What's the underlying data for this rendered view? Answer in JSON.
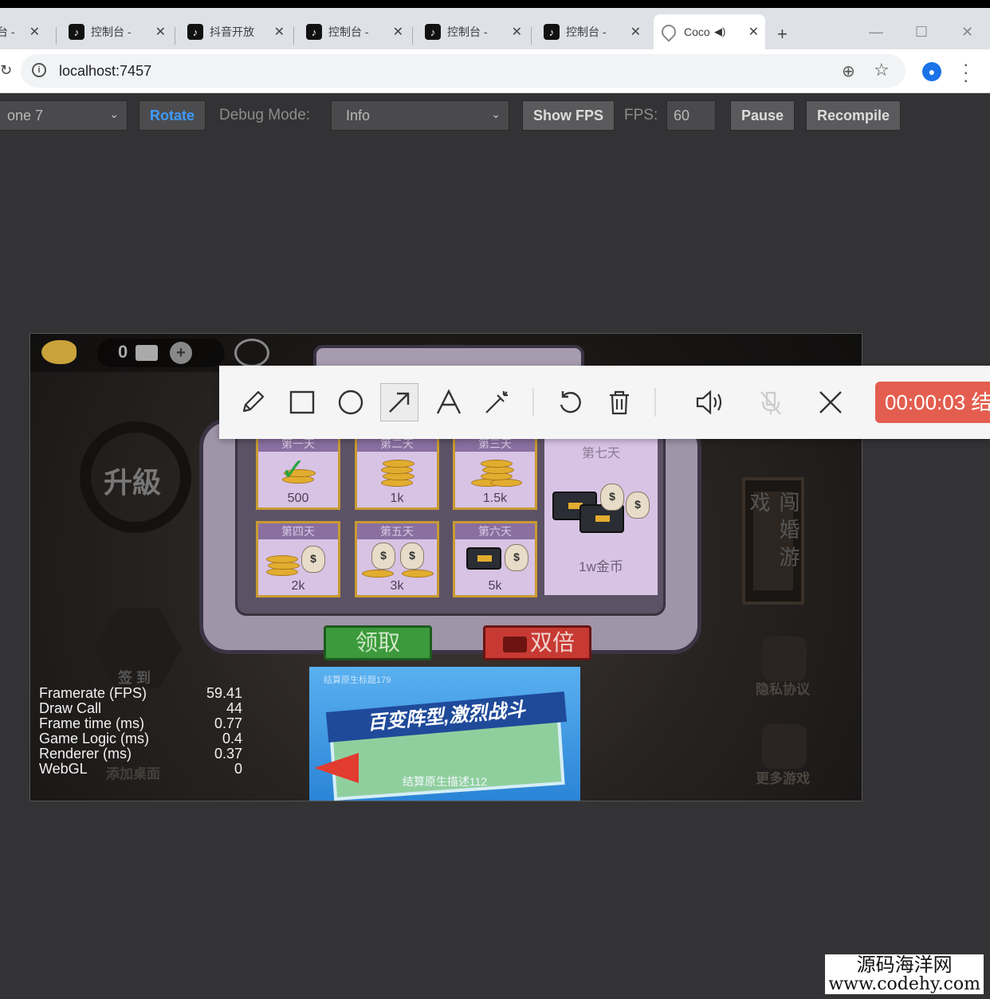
{
  "browser": {
    "tabs": [
      {
        "label": "台 -",
        "icon": "tiktok-icon"
      },
      {
        "label": "控制台 -",
        "icon": "tiktok-icon"
      },
      {
        "label": "抖音开放",
        "icon": "tiktok-icon"
      },
      {
        "label": "控制台 -",
        "icon": "tiktok-icon"
      },
      {
        "label": "控制台 -",
        "icon": "tiktok-icon"
      },
      {
        "label": "控制台 -",
        "icon": "tiktok-icon"
      },
      {
        "label": "Coco",
        "icon": "cocos-icon",
        "active": true,
        "audio": true
      }
    ],
    "new_tab": "+",
    "address": "localhost:7457"
  },
  "cocos_toolbar": {
    "device_select": "one 7",
    "rotate": "Rotate",
    "debug_label": "Debug Mode:",
    "debug_value": "Info",
    "show_fps": "Show FPS",
    "fps_label": "FPS:",
    "fps_value": "60",
    "pause": "Pause",
    "recompile": "Recompile"
  },
  "game": {
    "hud_count": "0",
    "upgrade": "升級",
    "side_sign": "闯 婚 游 戏",
    "signin": "签 到",
    "privacy": "隐私协议",
    "more_games": "更多游戏",
    "add_desktop": "添加桌面",
    "days": [
      {
        "head": "第一天",
        "value": "500",
        "claimed": true
      },
      {
        "head": "第二天",
        "value": "1k"
      },
      {
        "head": "第三天",
        "value": "1.5k"
      },
      {
        "head": "第四天",
        "value": "2k"
      },
      {
        "head": "第五天",
        "value": "3k"
      },
      {
        "head": "第六天",
        "value": "5k"
      }
    ],
    "day7": {
      "head": "第七天",
      "value": "1w金币"
    },
    "claim": "领取",
    "double": "双倍",
    "ad": {
      "title": "结算原生标题179",
      "banner": "百变阵型,激烈战斗",
      "desc": "结算原生描述112"
    },
    "stats": [
      {
        "label": "Framerate (FPS)",
        "value": "59.41"
      },
      {
        "label": "Draw Call",
        "value": "44"
      },
      {
        "label": "Frame time (ms)",
        "value": "0.77"
      },
      {
        "label": "Game Logic (ms)",
        "value": "0.4"
      },
      {
        "label": "Renderer (ms)",
        "value": "0.37"
      },
      {
        "label": "WebGL",
        "value": "0"
      }
    ]
  },
  "recorder": {
    "timer": "00:00:03 结"
  },
  "watermark": {
    "line1": "源码海洋网",
    "line2": "www.codehy.com"
  },
  "colors": {
    "page_bg": "#333335",
    "rotate_active": "#3d9bff",
    "timer_bg": "#e35e4f",
    "claim_green": "#3c9a3c",
    "double_red": "#c73a33"
  }
}
